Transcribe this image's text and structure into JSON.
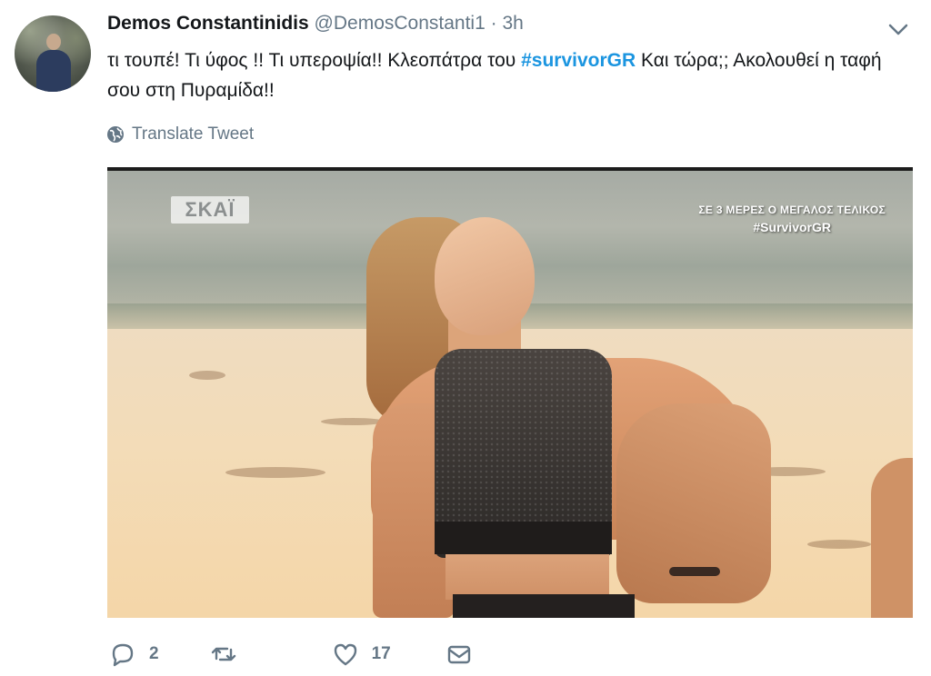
{
  "tweet": {
    "author_name": "Demos Constantinidis",
    "author_handle": "@DemosConstanti1",
    "separator": "·",
    "time": "3h",
    "text_part1": "τι τουπέ! Τι ύφος !! Τι υπεροψία!! Κλεοπάτρα του ",
    "hashtag": "#survivorGR",
    "text_part2": " Και τώρα;; Ακολουθεί η ταφή σου στη Πυραμίδα!!",
    "translate_label": "Translate Tweet"
  },
  "media": {
    "channel_logo": "ΣΚΑΪ",
    "promo_line1": "ΣΕ 3 ΜΕΡΕΣ Ο ΜΕΓΑΛΟΣ ΤΕΛΙΚΟΣ",
    "promo_line2": "#SurvivorGR"
  },
  "actions": {
    "reply_count": "2",
    "retweet_count": "",
    "like_count": "17"
  },
  "icons": {
    "reply": "reply-icon",
    "retweet": "retweet-icon",
    "like": "heart-icon",
    "dm": "envelope-icon",
    "translate": "globe-icon",
    "menu": "chevron-down-icon"
  },
  "colors": {
    "hashtag": "#1b95e0",
    "meta_text": "#657786",
    "primary_text": "#14171a"
  }
}
